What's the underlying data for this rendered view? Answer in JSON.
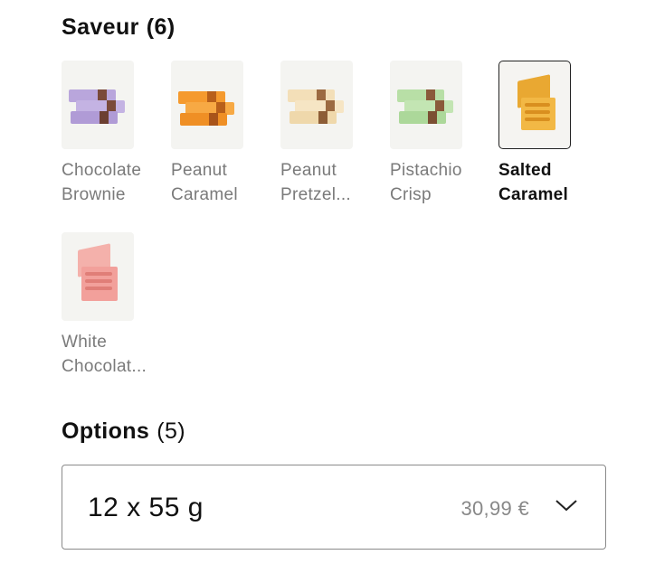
{
  "flavor_section": {
    "title": "Saveur",
    "count": "(6)",
    "items": [
      {
        "label_line1": "Chocolate",
        "label_line2": "Brownie",
        "icon": "chocolate-brownie-bar-image",
        "color": "#b9a6dc"
      },
      {
        "label_line1": "Peanut",
        "label_line2": "Caramel",
        "icon": "peanut-caramel-bar-image",
        "color": "#f59a2e"
      },
      {
        "label_line1": "Peanut",
        "label_line2": "Pretzel...",
        "icon": "peanut-pretzel-bar-image",
        "color": "#f3dfb8"
      },
      {
        "label_line1": "Pistachio",
        "label_line2": "Crisp",
        "icon": "pistachio-crisp-bar-image",
        "color": "#b8dfa6"
      },
      {
        "label_line1": "Salted",
        "label_line2": "Caramel",
        "icon": "salted-caramel-box-image",
        "color": "#f2b845",
        "selected": true
      },
      {
        "label_line1": "White",
        "label_line2": "Chocolat...",
        "icon": "white-chocolate-box-image",
        "color": "#f2a09b"
      }
    ]
  },
  "options_section": {
    "title": "Options",
    "count": "(5)",
    "selected_option": "12 x 55 g",
    "price": "30,99 €",
    "chevron_icon": "chevron-down-icon"
  }
}
